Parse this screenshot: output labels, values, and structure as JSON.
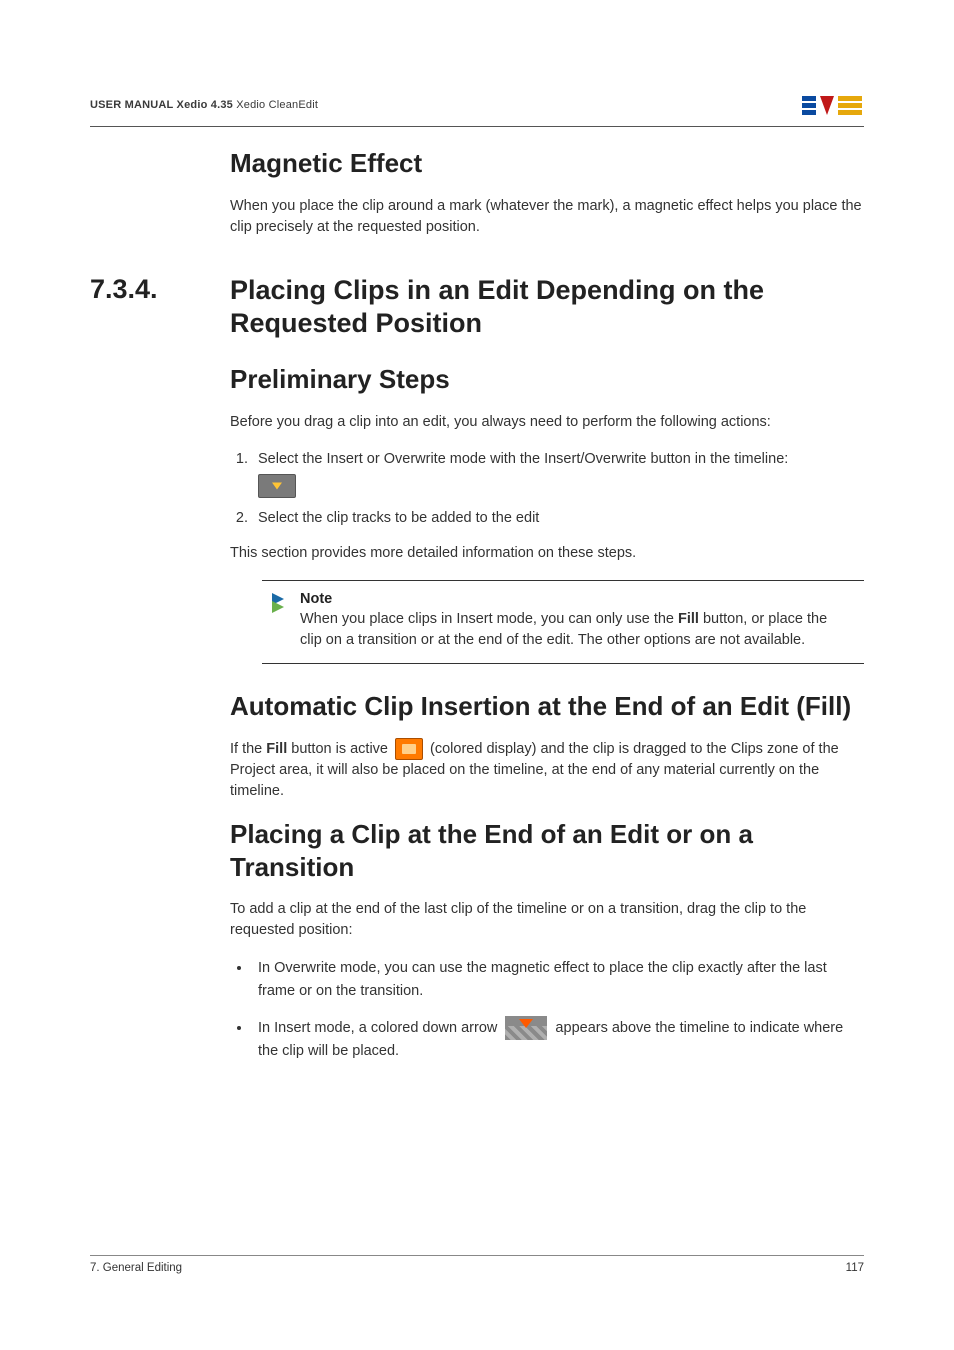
{
  "header": {
    "prefix": "USER MANUAL ",
    "product": "Xedio 4.35",
    "module": " Xedio CleanEdit"
  },
  "section1": {
    "title": "Magnetic Effect",
    "body": "When you place the clip around a mark (whatever the mark), a magnetic effect helps you place the clip precisely at the requested position."
  },
  "section2": {
    "number": "7.3.4.",
    "title": "Placing Clips in an Edit Depending on the Requested Position"
  },
  "prelim": {
    "title": "Preliminary Steps",
    "intro": "Before you drag a clip into an edit, you always need to perform the following actions:",
    "step1": "Select the Insert or Overwrite mode with the Insert/Overwrite button in the timeline:",
    "step2": "Select the clip tracks to be added to the edit",
    "outro": "This section provides more detailed information on these steps."
  },
  "note": {
    "title": "Note",
    "body_pre": "When you place clips in Insert mode, you can only use the ",
    "body_bold": "Fill",
    "body_post": " button, or place the clip on a transition or at the end of the edit. The other options are not available."
  },
  "auto": {
    "title": "Automatic Clip Insertion at the End of an Edit (Fill)",
    "p1_a": "If the ",
    "p1_b": "Fill",
    "p1_c": " button is active ",
    "p1_d": " (colored display) and the clip is dragged to the Clips zone of the Project area, it will also be placed on the timeline, at the end of any material currently on the timeline."
  },
  "placing": {
    "title": "Placing a Clip at the End of an Edit or on a Transition",
    "intro": "To add a clip at the end of the last clip of the timeline or on a transition, drag the clip to the requested position:",
    "b1": "In Overwrite mode, you can use the magnetic effect to place the clip exactly after the last frame or on the transition.",
    "b2_a": "In Insert mode, a colored down arrow ",
    "b2_b": " appears above the timeline to indicate where the clip will be placed."
  },
  "footer": {
    "left": "7. General Editing",
    "right": "117"
  }
}
